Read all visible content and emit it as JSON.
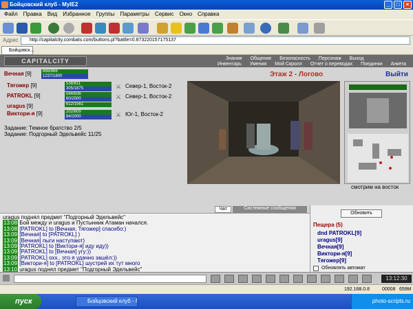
{
  "window": {
    "title": "Бойцовский клуб - MyIE2"
  },
  "menu": [
    "Файл",
    "Правка",
    "Вид",
    "Избранное",
    "Группы",
    "Параметры",
    "Сервис",
    "Окно",
    "Справка"
  ],
  "address": {
    "label": "Адрес",
    "url": "http://capitalcity.combats.com/buttons.pl?battle=0.873220157175137"
  },
  "tabs": [
    {
      "label": "Бойцовск..."
    }
  ],
  "game": {
    "logo": "CAPITALCITY",
    "nav_top": [
      "Знания",
      "Общение",
      "Безопасность",
      "Персонаж",
      "Выход"
    ],
    "nav_bottom": [
      "Инвентарь",
      "Умения",
      "Мой Скролл",
      "Отчет о переводах",
      "Поединки",
      "Анкета"
    ],
    "location": "Этаж 2 - Логово",
    "exit_label": "Выйти",
    "viewing_label": "смотрим на восток",
    "self": {
      "name": "Вечная",
      "level": "[9]",
      "hp": "866/866",
      "mp": "1237/1800"
    },
    "party": [
      {
        "name": "Тягожер",
        "level": "[9]",
        "hp": "538/811",
        "mp": "305/1875",
        "position": "Север-1, Восток-2"
      },
      {
        "name": "PATROKL",
        "level": "[9]",
        "hp": "564/836",
        "mp": "60/2000",
        "position": "Север-1, Восток-2"
      },
      {
        "name": "uragus",
        "level": "[9]",
        "hp": "612/1561",
        "mp": "",
        "position": ""
      },
      {
        "name": "Виктори-я",
        "level": "[9]",
        "hp": "202/609",
        "mp": "84/2000",
        "position": "Юг-1, Восток-2"
      }
    ],
    "quests": [
      "Задание: Темное братство 2/5",
      "Задание: Подгорный Эдельвейс 11/25"
    ]
  },
  "chat": {
    "tab_chat": "Чат",
    "tab_system": "Системные сообщения",
    "lines": [
      {
        "time": "",
        "text": "uragus поднял предмет \"Подгорный Эдельвейс\""
      },
      {
        "time": "13:08",
        "text": "Бой между и uragus и Пустынник Атаман начался."
      },
      {
        "time": "13:08",
        "text": "[PATROKL] to [Вечная, Тягожер] спасибо:)"
      },
      {
        "time": "13:09",
        "text": "[Вечная] to [PATROKL] )"
      },
      {
        "time": "13:09",
        "text": "[Вечная] пыги наступают)"
      },
      {
        "time": "13:09",
        "text": "[PATROKL] to [Виктори-я] иду иду))"
      },
      {
        "time": "13:09",
        "text": "[PATROKL] to [Вечная] угу:))"
      },
      {
        "time": "13:09",
        "text": "[PATROKL] охх.. это я удачно зашёл:))"
      },
      {
        "time": "13:09",
        "text": "[Виктори-я] to [PATROKL] шустрей их тут много"
      },
      {
        "time": "13:10",
        "text": "uragus поднял предмет \"Подгорный Эдельвейс\""
      }
    ]
  },
  "roster": {
    "refresh_label": "Обновить",
    "title": "Пещера (5)",
    "members": [
      "dnd PATROKL[9]",
      "uragus[9]",
      "Вечная[9]",
      "Виктори-я[9]",
      "Тягожер[9]"
    ],
    "auto_refresh_label": "Обновлять автомат"
  },
  "clock": "13:12:30",
  "status": {
    "ip": "192.168.0.8",
    "mem": "659M",
    "counter": "00008"
  },
  "taskbar": {
    "start": "пуск",
    "task": "Бойцовский клуб - M...",
    "watermark": "photo-scripts.ru"
  },
  "colors": {
    "title_bg": "#0842b0",
    "hp": "#1a7a1a",
    "mp": "#2848a8",
    "time_badge": "#1a8a1a",
    "name": "#800000"
  }
}
